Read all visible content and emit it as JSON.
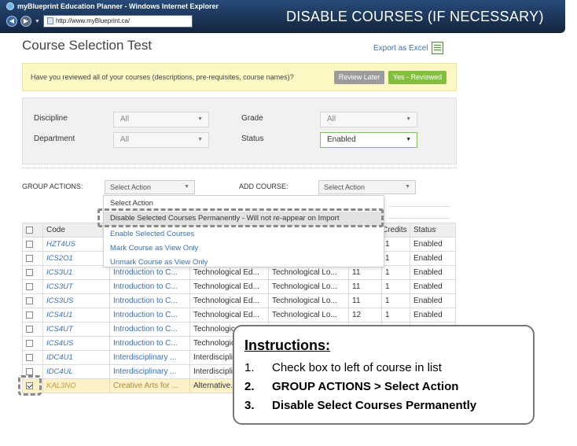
{
  "browser": {
    "window_title": "myBlueprint Education Planner - Windows Internet Explorer",
    "url": "http://www.myBlueprint.ca/"
  },
  "slide_title": "DISABLE COURSES (IF NECESSARY)",
  "page": {
    "title": "Course Selection Test",
    "export_label": "Export as Excel"
  },
  "review": {
    "question": "Have you reviewed all of your courses (descriptions, pre-requisites, course names)?",
    "later_label": "Review Later",
    "yes_label": "Yes - Reviewed"
  },
  "filters": {
    "discipline_label": "Discipline",
    "discipline_value": "All",
    "department_label": "Department",
    "department_value": "All",
    "grade_label": "Grade",
    "grade_value": "All",
    "status_label": "Status",
    "status_value": "Enabled"
  },
  "actions": {
    "group_label": "GROUP ACTIONS:",
    "group_value": "Select Action",
    "add_label": "ADD COURSE:",
    "add_value": "Select Action"
  },
  "menu": {
    "items": [
      "Select Action",
      "Disable Selected Courses Permanently - Will not re-appear on Import",
      "Enable Selected Courses",
      "Mark Course as View Only",
      "Unmark Course as View Only"
    ],
    "selected_index": 1
  },
  "table": {
    "headers": [
      "Code",
      "",
      "",
      "",
      "Credits",
      "Status"
    ],
    "rows": [
      {
        "code": "HZT4US",
        "title": "",
        "dept": "",
        "disc": "",
        "grade": "",
        "credits": "1",
        "status": "Enabled",
        "checked": false
      },
      {
        "code": "ICS2O1",
        "title": "",
        "dept": "",
        "disc": "",
        "grade": "",
        "credits": "1",
        "status": "Enabled",
        "checked": false
      },
      {
        "code": "ICS3U1",
        "title": "Introduction to C...",
        "dept": "Technological Ed...",
        "disc": "Technological Lo...",
        "grade": "11",
        "credits": "1",
        "status": "Enabled",
        "checked": false
      },
      {
        "code": "ICS3UT",
        "title": "Introduction to C...",
        "dept": "Technological Ed...",
        "disc": "Technological Lo...",
        "grade": "11",
        "credits": "1",
        "status": "Enabled",
        "checked": false
      },
      {
        "code": "ICS3US",
        "title": "Introduction to C...",
        "dept": "Technological Ed...",
        "disc": "Technological Lo...",
        "grade": "11",
        "credits": "1",
        "status": "Enabled",
        "checked": false
      },
      {
        "code": "ICS4U1",
        "title": "Introduction to C...",
        "dept": "Technological Ed...",
        "disc": "Technological Lo...",
        "grade": "12",
        "credits": "1",
        "status": "Enabled",
        "checked": false
      },
      {
        "code": "ICS4UT",
        "title": "Introduction to C...",
        "dept": "Technological Ed...",
        "disc": "",
        "grade": "",
        "credits": "",
        "status": "",
        "checked": false
      },
      {
        "code": "ICS4US",
        "title": "Introduction to C...",
        "dept": "Technological Ed...",
        "disc": "",
        "grade": "",
        "credits": "",
        "status": "",
        "checked": false
      },
      {
        "code": "IDC4U1",
        "title": "Interdisciplinary ...",
        "dept": "Interdisciplinar...",
        "disc": "",
        "grade": "",
        "credits": "",
        "status": "",
        "checked": false
      },
      {
        "code": "IDC4UL",
        "title": "Interdisciplinary ...",
        "dept": "Interdisciplinar...",
        "disc": "",
        "grade": "",
        "credits": "",
        "status": "",
        "checked": false
      },
      {
        "code": "KAL3NO",
        "title": "Creative Arts for ...",
        "dept": "Alternative...",
        "disc": "",
        "grade": "",
        "credits": "",
        "status": "",
        "checked": true
      }
    ]
  },
  "instructions": {
    "title": "Instructions:",
    "steps": [
      {
        "num": "1.",
        "text": "Check box to left of course in list"
      },
      {
        "num": "2.",
        "text": "GROUP ACTIONS > Select Action"
      },
      {
        "num": "3.",
        "text": "Disable Select Courses Permanently"
      }
    ]
  },
  "colors": {
    "link": "#3b6fb6",
    "yes_button": "#83bf3e",
    "later_button": "#9b9b9b",
    "banner": "#fdf7c4",
    "highlight_row": "#fdf1c8"
  }
}
